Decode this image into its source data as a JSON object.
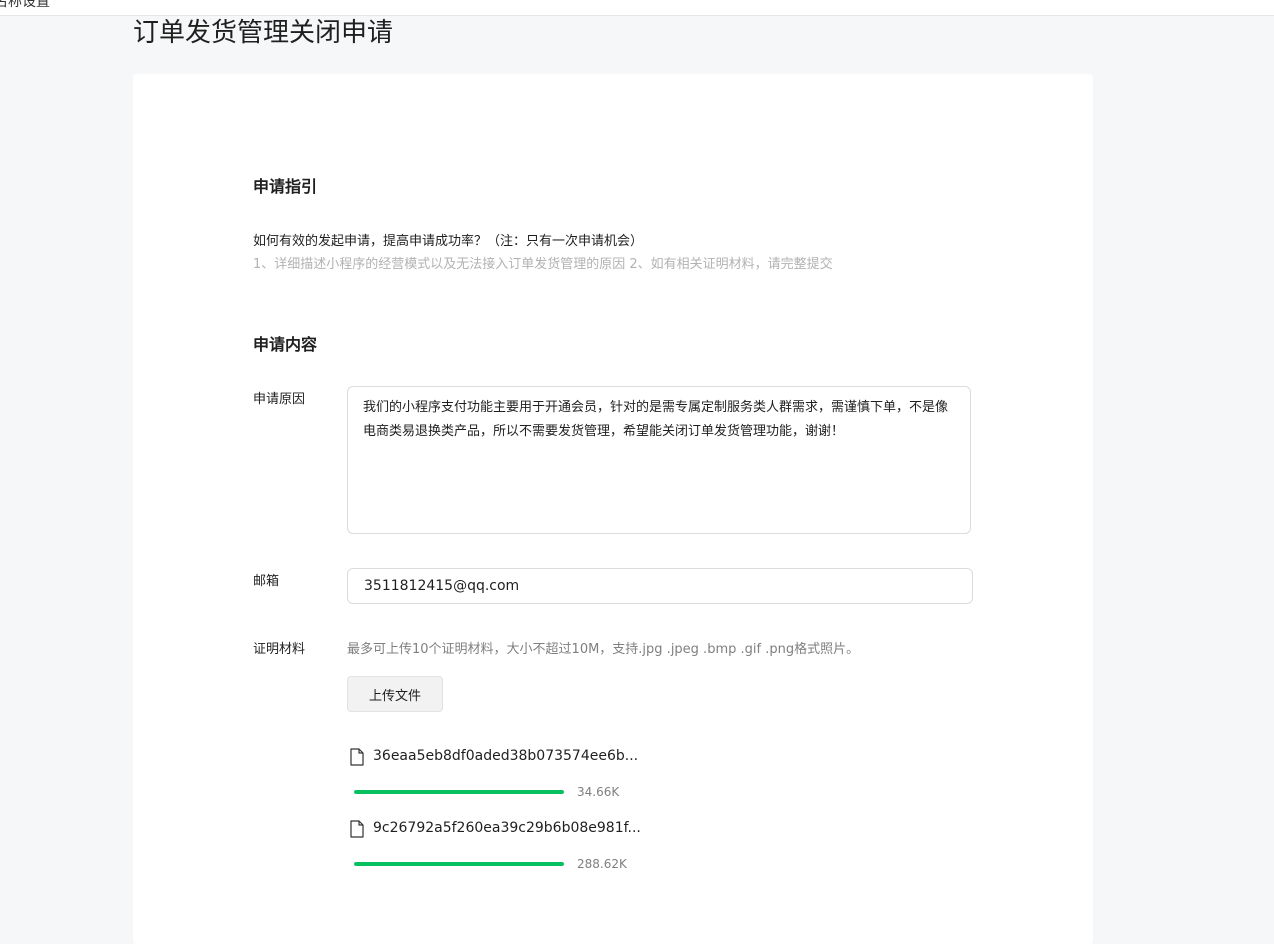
{
  "topbar": {
    "fragment": "名称设置"
  },
  "page": {
    "title": "订单发货管理关闭申请"
  },
  "guide": {
    "section_title": "申请指引",
    "question": "如何有效的发起申请，提高申请成功率？（注：只有一次申请机会）",
    "tips": "1、详细描述小程序的经营模式以及无法接入订单发货管理的原因 2、如有相关证明材料，请完整提交"
  },
  "content": {
    "section_title": "申请内容",
    "reason_label": "申请原因",
    "reason_value": "我们的小程序支付功能主要用于开通会员，针对的是需专属定制服务类人群需求，需谨慎下单，不是像电商类易退换类产品，所以不需要发货管理，希望能关闭订单发货管理功能，谢谢！",
    "email_label": "邮箱",
    "email_value": "3511812415@qq.com",
    "material_label": "证明材料",
    "upload_hint": "最多可上传10个证明材料，大小不超过10M，支持.jpg .jpeg .bmp .gif .png格式照片。",
    "upload_button": "上传文件",
    "files": [
      {
        "name": "36eaa5eb8df0aded38b073574ee6b...",
        "size": "34.66K",
        "progress": 1.0
      },
      {
        "name": "9c26792a5f260ea39c29b6b08e981f...",
        "size": "288.62K",
        "progress": 1.0
      }
    ]
  },
  "colors": {
    "progress": "#07c160",
    "muted": "#b2b2b2"
  },
  "icons": {
    "file": "file-icon"
  }
}
